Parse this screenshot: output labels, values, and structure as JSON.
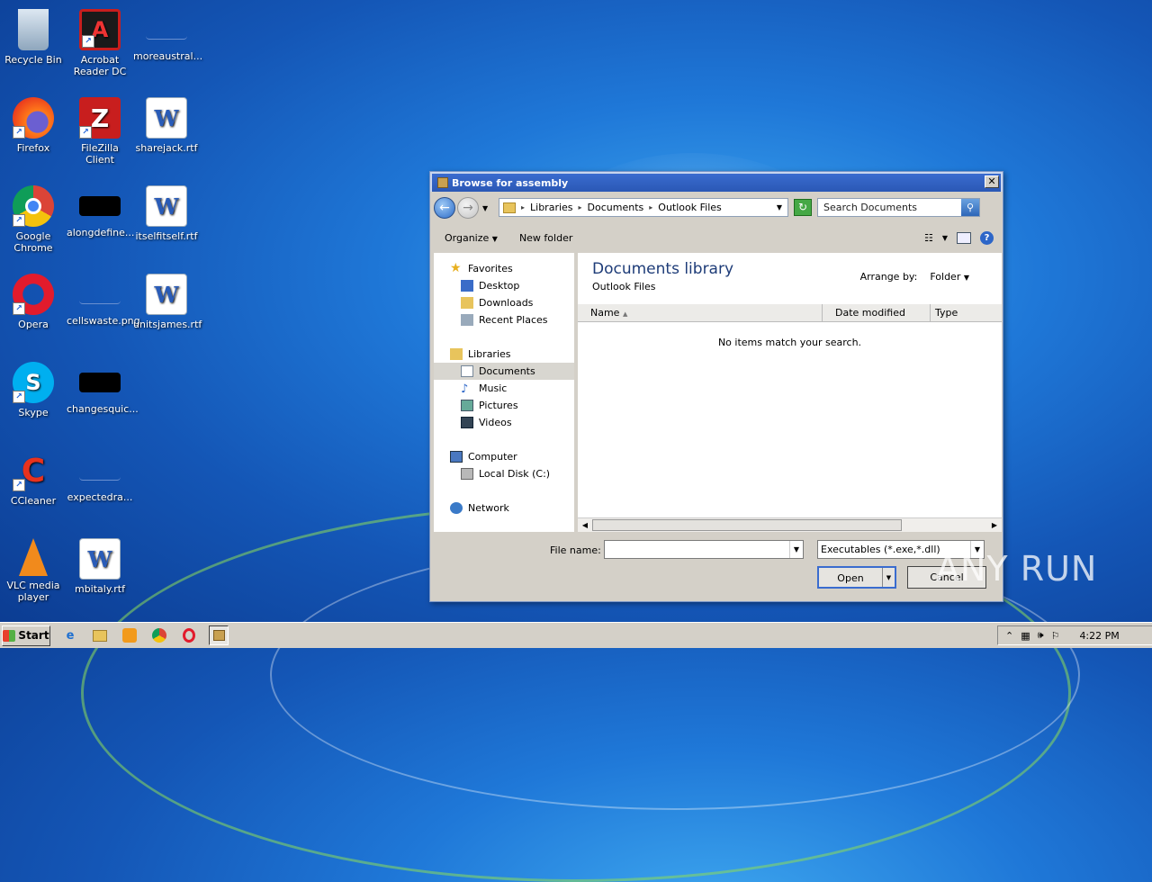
{
  "desktop": {
    "icons": [
      {
        "label": "Recycle Bin"
      },
      {
        "label": "Acrobat Reader DC"
      },
      {
        "label": "moreaustral..."
      },
      {
        "label": "Firefox"
      },
      {
        "label": "FileZilla Client"
      },
      {
        "label": "sharejack.rtf"
      },
      {
        "label": "Google Chrome"
      },
      {
        "label": "alongdefine..."
      },
      {
        "label": "itselfitself.rtf"
      },
      {
        "label": "Opera"
      },
      {
        "label": "cellswaste.png"
      },
      {
        "label": "unitsjames.rtf"
      },
      {
        "label": "Skype"
      },
      {
        "label": "changesquic..."
      },
      {
        "label": "CCleaner"
      },
      {
        "label": "expectedra..."
      },
      {
        "label": "VLC media player"
      },
      {
        "label": "mbitaly.rtf"
      }
    ]
  },
  "dialog": {
    "title": "Browse for assembly",
    "close": "✕",
    "breadcrumb": [
      "Libraries",
      "Documents",
      "Outlook Files"
    ],
    "search_placeholder": "Search Documents",
    "toolbar": {
      "organize": "Organize",
      "new_folder": "New folder"
    },
    "nav": {
      "favorites": "Favorites",
      "desktop": "Desktop",
      "downloads": "Downloads",
      "recent": "Recent Places",
      "libraries": "Libraries",
      "documents": "Documents",
      "music": "Music",
      "pictures": "Pictures",
      "videos": "Videos",
      "computer": "Computer",
      "local_disk": "Local Disk (C:)",
      "network": "Network"
    },
    "content": {
      "title": "Documents library",
      "subtitle": "Outlook Files",
      "arrange_label": "Arrange by:",
      "arrange_value": "Folder",
      "columns": [
        "Name",
        "Date modified",
        "Type"
      ],
      "empty_message": "No items match your search."
    },
    "file_name_label": "File name:",
    "file_name_value": "",
    "file_type": "Executables (*.exe,*.dll)",
    "open": "Open",
    "cancel": "Cancel"
  },
  "taskbar": {
    "start": "Start",
    "clock": "4:22 PM"
  },
  "watermark": "ANY RUN"
}
